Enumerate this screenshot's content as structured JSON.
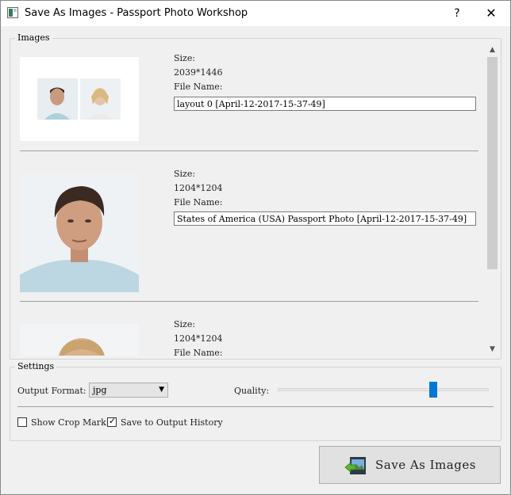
{
  "window": {
    "title": "Save As Images - Passport Photo Workshop",
    "help": "?",
    "close": "✕"
  },
  "images": {
    "label": "Images",
    "items": [
      {
        "size_label": "Size:",
        "size": "2039*1446",
        "file_label": "File Name:",
        "file_name": "layout 0 [April-12-2017-15-37-49]"
      },
      {
        "size_label": "Size:",
        "size": "1204*1204",
        "file_label": "File Name:",
        "file_name": "States of America (USA) Passport Photo [April-12-2017-15-37-49]"
      },
      {
        "size_label": "Size:",
        "size": "1204*1204",
        "file_label": "File Name:",
        "file_name": ""
      }
    ]
  },
  "settings": {
    "label": "Settings",
    "format_label": "Output Format:",
    "format_value": "jpg",
    "quality_label": "Quality:",
    "quality_value": 0.75,
    "show_crop_mark": {
      "label": "Show Crop Mark",
      "checked": false
    },
    "save_history": {
      "label": "Save to Output History",
      "checked": true
    }
  },
  "save_button": {
    "label": "Save As Images"
  },
  "colors": {
    "accent": "#0078d7",
    "background": "#f0f0f0"
  }
}
